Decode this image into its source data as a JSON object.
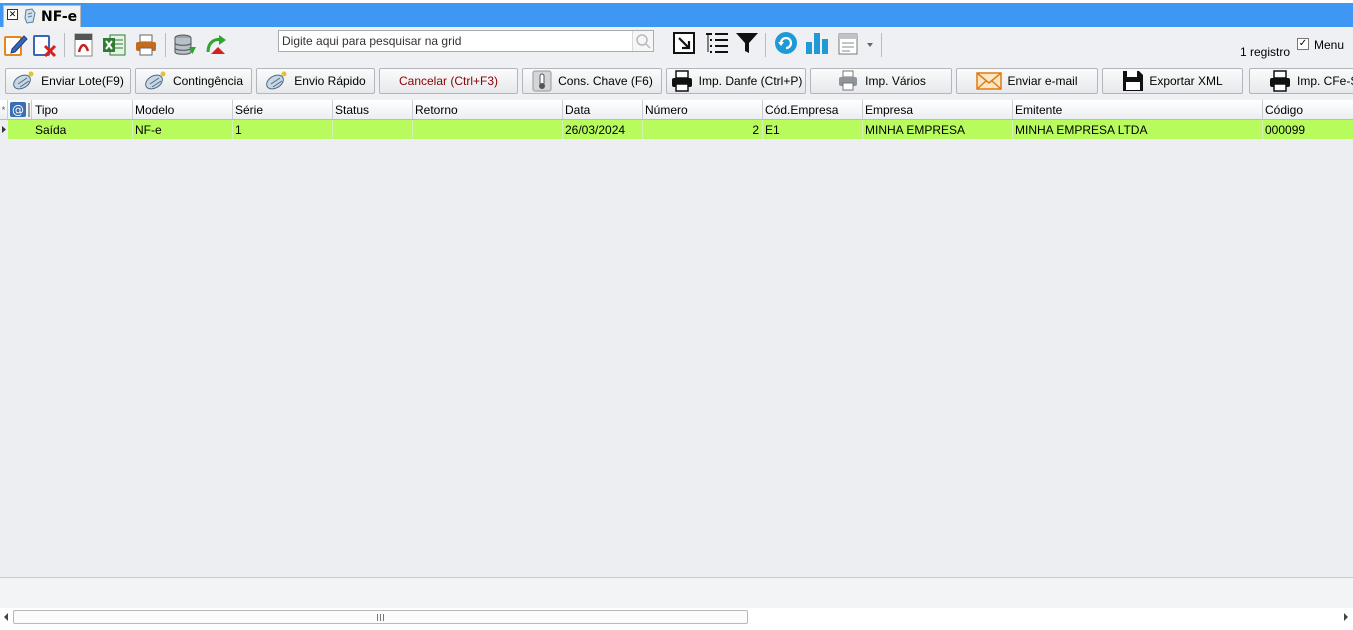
{
  "tab": {
    "title": "NF-e",
    "close_glyph": "✕"
  },
  "toolbar": {
    "icons": [
      "edit-icon",
      "delete-icon",
      "pdf-icon",
      "excel-icon",
      "printer-icon",
      "database-icon",
      "refresh-arrow-icon",
      "expand-icon",
      "tree-list-icon",
      "filter-icon",
      "reload-icon",
      "bar-chart-icon",
      "report-icon"
    ],
    "search": {
      "placeholder": "Digite aqui para pesquisar na grid",
      "value": ""
    },
    "record_count": "1 registro",
    "menu": {
      "label": "Menu",
      "checked": true,
      "glyph": "✓"
    }
  },
  "actions": {
    "enviar_lote": "Enviar Lote(F9)",
    "contingencia": "Contingência",
    "envio_rapido": "Envio Rápido",
    "cancelar": "Cancelar (Ctrl+F3)",
    "cons_chave": "Cons. Chave (F6)",
    "imp_danfe": "Imp. Danfe (Ctrl+P)",
    "imp_varios": "Imp. Vários",
    "enviar_email": "Enviar e-mail",
    "exportar_xml": "Exportar XML",
    "imp_cfe": "Imp. CFe-S"
  },
  "grid": {
    "columns": {
      "tipo": "Tipo",
      "modelo": "Modelo",
      "serie": "Série",
      "status": "Status",
      "retorno": "Retorno",
      "data": "Data",
      "numero": "Número",
      "cod_empresa": "Cód.Empresa",
      "empresa": "Empresa",
      "emitente": "Emitente",
      "codigo": "Código"
    },
    "rows": [
      {
        "tipo": "Saída",
        "modelo": "NF-e",
        "serie": "1",
        "status": "",
        "retorno": "",
        "data": "26/03/2024",
        "numero": "2",
        "cod_empresa": "E1",
        "empresa": "MINHA EMPRESA",
        "emitente": "MINHA EMPRESA LTDA",
        "codigo": "000099"
      }
    ]
  },
  "colors": {
    "tabstrip": "#3f97f4",
    "selected_row": "#b7fc5c",
    "grid_bg": "#eceef1"
  }
}
